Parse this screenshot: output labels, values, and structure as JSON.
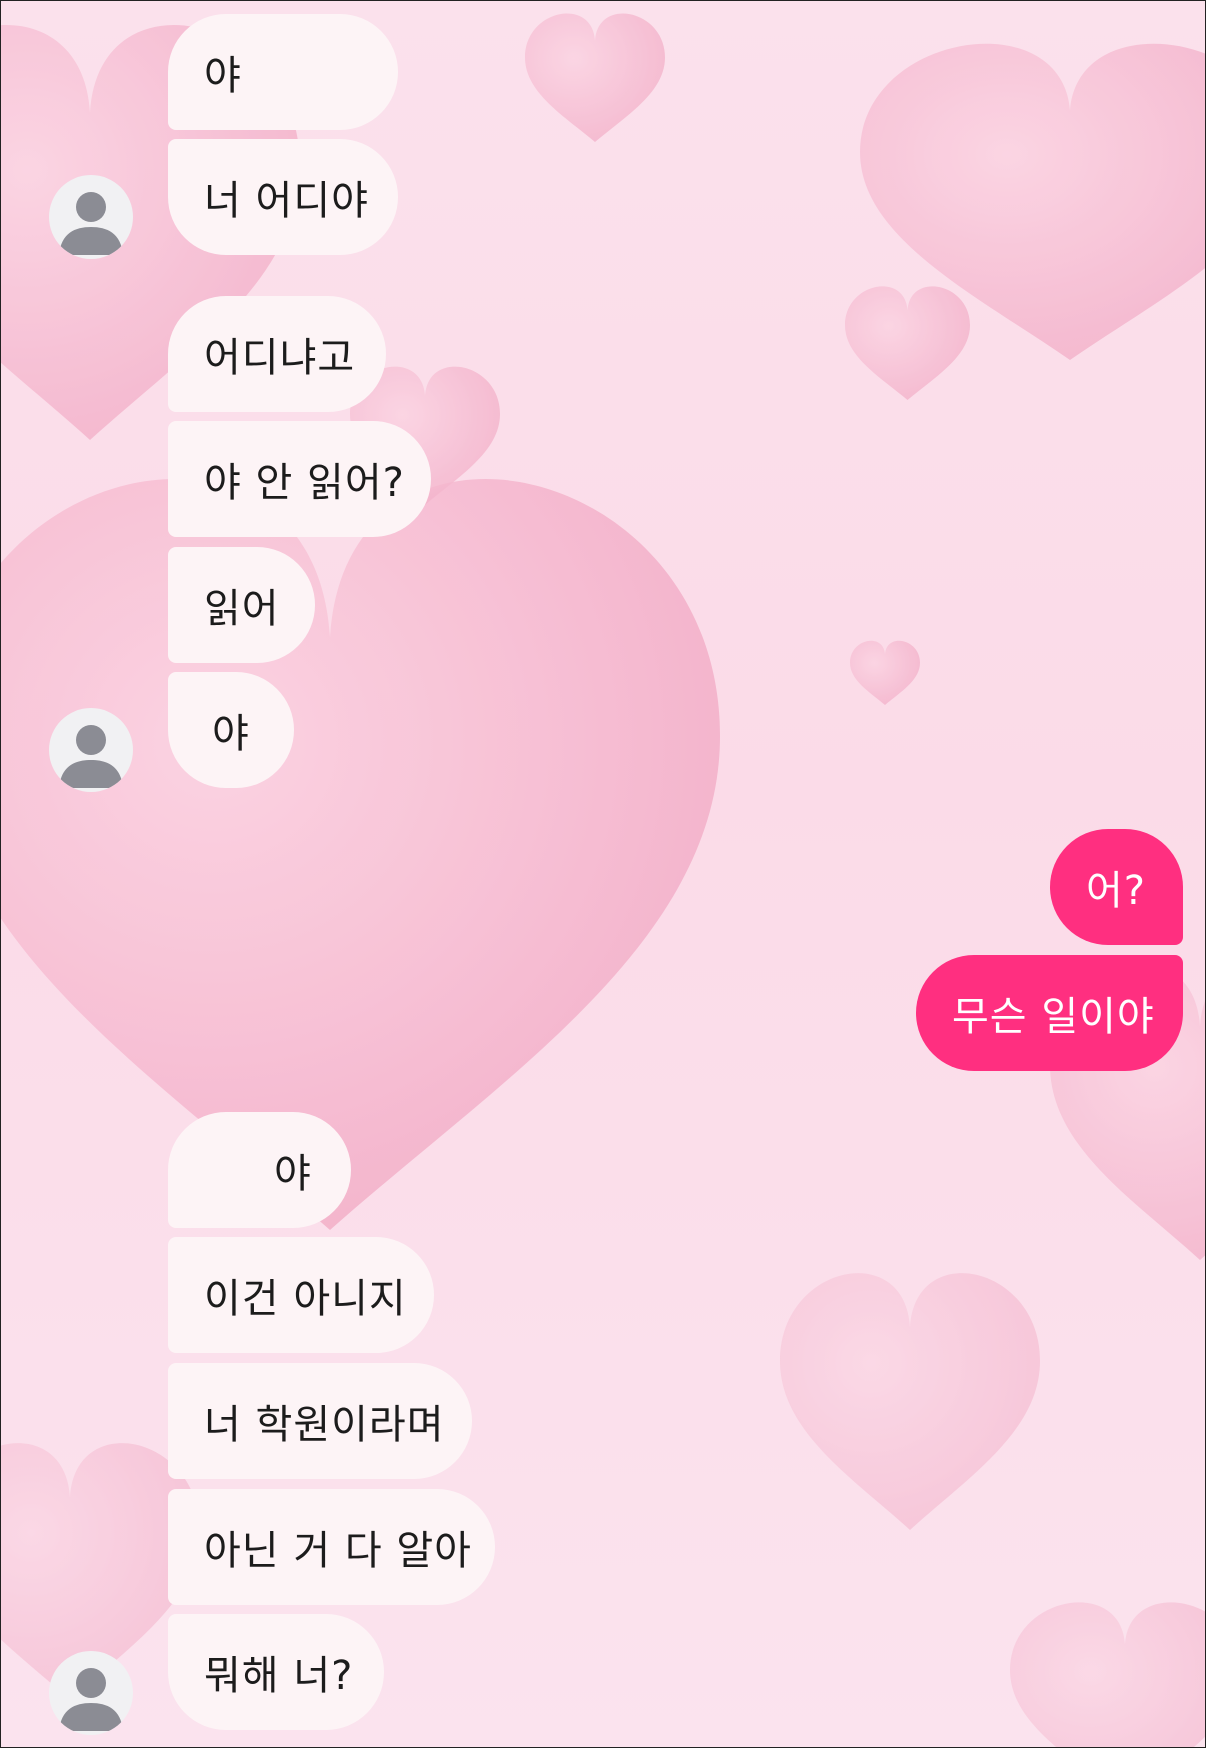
{
  "colors": {
    "background": "#fbdfea",
    "incoming_bubble": "#fdf4f6",
    "outgoing_bubble": "#ff2f80",
    "avatar_silhouette": "#8b8c94"
  },
  "wallpaper": {
    "motif": "heart-icon"
  },
  "messages": [
    {
      "sender": "other",
      "text": "야"
    },
    {
      "sender": "other",
      "text": "너 어디야"
    },
    {
      "sender": "other",
      "text": "어디냐고"
    },
    {
      "sender": "other",
      "text": "야 안 읽어?"
    },
    {
      "sender": "other",
      "text": "읽어"
    },
    {
      "sender": "other",
      "text": "야"
    },
    {
      "sender": "me",
      "text": "어?"
    },
    {
      "sender": "me",
      "text": "무슨 일이야"
    },
    {
      "sender": "other",
      "text": "야"
    },
    {
      "sender": "other",
      "text": "이건 아니지"
    },
    {
      "sender": "other",
      "text": "너 학원이라며"
    },
    {
      "sender": "other",
      "text": "아닌 거 다 알아"
    },
    {
      "sender": "other",
      "text": "뭐해 너?"
    }
  ]
}
